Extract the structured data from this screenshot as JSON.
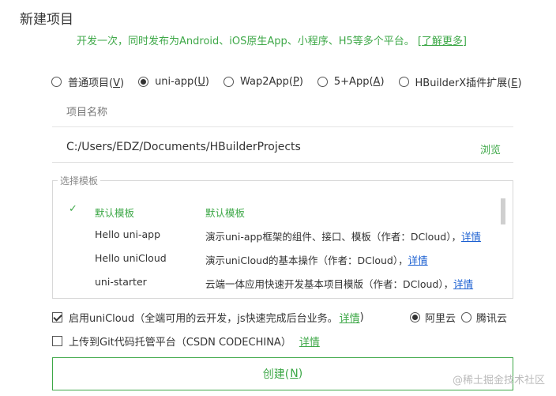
{
  "dialog": {
    "title": "新建项目"
  },
  "subtitle": {
    "text": "开发一次，同时发布为Android、iOS原生App、小程序、H5等多个平台。",
    "more_link": "[了解更多]"
  },
  "project_types": [
    {
      "label": "普通项目(",
      "key": "V",
      "end": ")",
      "selected": false
    },
    {
      "label": "uni-app(",
      "key": "U",
      "end": ")",
      "selected": true
    },
    {
      "label": "Wap2App(",
      "key": "P",
      "end": ")",
      "selected": false
    },
    {
      "label": "5+App(",
      "key": "A",
      "end": ")",
      "selected": false
    },
    {
      "label": "HBuilderX插件扩展(",
      "key": "E",
      "end": ")",
      "selected": false
    }
  ],
  "project_name": {
    "placeholder": "项目名称",
    "value": ""
  },
  "location": {
    "path": "C:/Users/EDZ/Documents/HBuilderProjects",
    "browse_label": "浏览"
  },
  "template_section": {
    "legend": "选择模板",
    "check_mark": "✓",
    "items": [
      {
        "name": "默认模板",
        "desc": "默认模板",
        "detail": "",
        "selected": true
      },
      {
        "name": "Hello uni-app",
        "desc": "演示uni-app框架的组件、接口、模板（作者：DCloud），",
        "detail": "详情",
        "selected": false
      },
      {
        "name": "Hello uniCloud",
        "desc": "演示uniCloud的基本操作（作者：DCloud），",
        "detail": "详情",
        "selected": false
      },
      {
        "name": "uni-starter",
        "desc": "云端一体应用快速开发基本项目模版（作者：DCloud），",
        "detail": "详情",
        "selected": false
      }
    ]
  },
  "unicloud": {
    "checked": true,
    "label": "启用uniCloud",
    "hint": "（全端可用的云开发，js快速完成后台业务。",
    "detail_link": "详情",
    "hint_end": ")",
    "providers": [
      {
        "label": "阿里云",
        "selected": true
      },
      {
        "label": "腾讯云",
        "selected": false
      }
    ]
  },
  "git": {
    "checked": false,
    "label": "上传到Git代码托管平台（CSDN CODECHINA）",
    "detail_link": "详情"
  },
  "create_button": {
    "label": "创建(",
    "key": "N",
    "end": ")"
  },
  "watermark": "@稀土掘金技术社区"
}
